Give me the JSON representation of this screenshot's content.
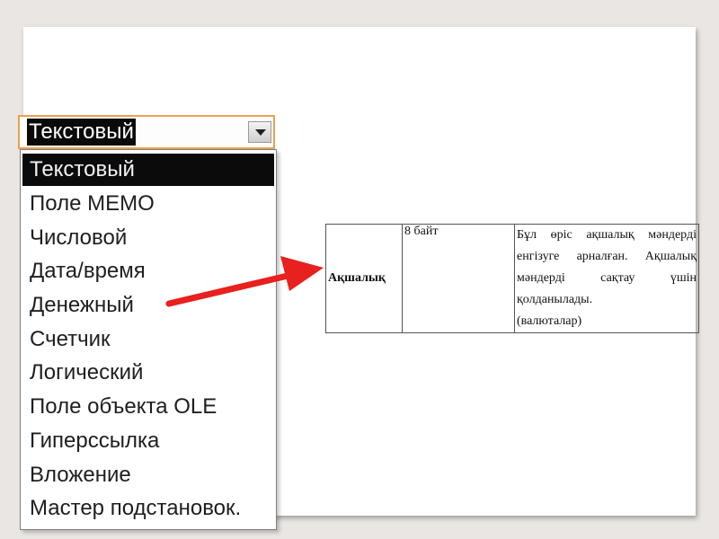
{
  "combo": {
    "selected": "Текстовый",
    "button_icon": "chevron-down-icon"
  },
  "dropdown": {
    "items": [
      "Текстовый",
      "Поле МЕМО",
      "Числовой",
      "Дата/время",
      "Денежный",
      "Счетчик",
      "Логический",
      "Поле объекта OLE",
      "Гиперссылка",
      "Вложение",
      "Мастер подстановок."
    ],
    "highlighted_index": 0
  },
  "table": {
    "name": "Ақшалық",
    "size": "8 байт",
    "description_line1": "Бұл өріс ақшалық мәндерді енгізуге арналған. Ақшалық мәндерді сақтау үшін қолданылады.",
    "description_line2": "(валюталар)"
  },
  "colors": {
    "arrow": "#e8201e",
    "combo_border": "#e9a24c",
    "highlight_bg": "#0b0b0b"
  }
}
